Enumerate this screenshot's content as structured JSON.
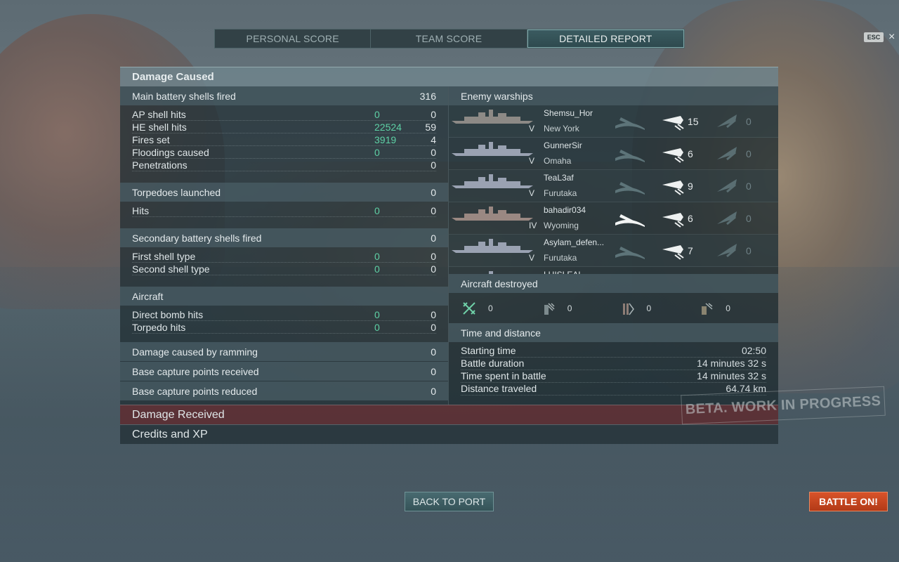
{
  "tabs": [
    {
      "label": "PERSONAL SCORE",
      "active": false
    },
    {
      "label": "TEAM SCORE",
      "active": false
    },
    {
      "label": "DETAILED REPORT",
      "active": true
    }
  ],
  "esc_label": "ESC",
  "close_label": "×",
  "damage_caused": {
    "title": "Damage Caused",
    "main_battery": {
      "header": "Main battery shells fired",
      "header_value": "316",
      "rows": [
        {
          "label": "AP shell hits",
          "damage": "0",
          "count": "0"
        },
        {
          "label": "HE shell hits",
          "damage": "22524",
          "count": "59"
        },
        {
          "label": "Fires set",
          "damage": "3919",
          "count": "4"
        },
        {
          "label": "Floodings caused",
          "damage": "0",
          "count": "0"
        },
        {
          "label": "Penetrations",
          "damage": "",
          "count": "0"
        }
      ]
    },
    "torpedoes": {
      "header": "Torpedoes launched",
      "header_value": "0",
      "rows": [
        {
          "label": "Hits",
          "damage": "0",
          "count": "0"
        }
      ]
    },
    "secondary": {
      "header": "Secondary battery shells fired",
      "header_value": "0",
      "rows": [
        {
          "label": "First shell type",
          "damage": "0",
          "count": "0"
        },
        {
          "label": "Second shell type",
          "damage": "0",
          "count": "0"
        }
      ]
    },
    "aircraft": {
      "header": "Aircraft",
      "header_value": "",
      "rows": [
        {
          "label": "Direct bomb hits",
          "damage": "0",
          "count": "0"
        },
        {
          "label": "Torpedo hits",
          "damage": "0",
          "count": "0"
        }
      ]
    },
    "ramming": {
      "label": "Damage caused by ramming",
      "value": "0"
    },
    "capture_received": {
      "label": "Base capture points received",
      "value": "0"
    },
    "capture_reduced": {
      "label": "Base capture points reduced",
      "value": "0"
    }
  },
  "enemy_warships": {
    "header": "Enemy warships",
    "ships": [
      {
        "player": "Shemsu_Hor",
        "ship": "New York",
        "tier": "V",
        "hits": "15",
        "other": "0",
        "sunk": false,
        "hull": "#8d8a86"
      },
      {
        "player": "GunnerSir",
        "ship": "Omaha",
        "tier": "V",
        "hits": "6",
        "other": "0",
        "sunk": false,
        "hull": "#9aa2b2"
      },
      {
        "player": "TeaL3af",
        "ship": "Furutaka",
        "tier": "V",
        "hits": "9",
        "other": "0",
        "sunk": false,
        "hull": "#9aa2b2"
      },
      {
        "player": "bahadir034",
        "ship": "Wyoming",
        "tier": "IV",
        "hits": "6",
        "other": "0",
        "sunk": true,
        "hull": "#9a8882"
      },
      {
        "player": "Asylam_defen...",
        "ship": "Furutaka",
        "tier": "V",
        "hits": "7",
        "other": "0",
        "sunk": false,
        "hull": "#9aa2b2"
      },
      {
        "player": "LUISLEAL",
        "ship": "",
        "tier": "",
        "hits": "",
        "other": "",
        "sunk": false,
        "hull": "#9aa2b2"
      }
    ]
  },
  "aircraft_destroyed": {
    "header": "Aircraft destroyed",
    "items": [
      {
        "icon": "fighter-icon",
        "value": "0"
      },
      {
        "icon": "dive-bomber-icon",
        "value": "0"
      },
      {
        "icon": "torpedo-bomber-icon",
        "value": "0"
      },
      {
        "icon": "catapult-fighter-icon",
        "value": "0"
      }
    ]
  },
  "time_distance": {
    "header": "Time and distance",
    "rows": [
      {
        "label": "Starting time",
        "value": "02:50"
      },
      {
        "label": "Battle duration",
        "value": "14 minutes 32 s"
      },
      {
        "label": "Time spent in battle",
        "value": "14 minutes 32 s"
      },
      {
        "label": "Distance traveled",
        "value": "64.74 km"
      }
    ]
  },
  "damage_received": "Damage Received",
  "credits_xp": "Credits and XP",
  "watermark": "BETA. WORK IN PROGRESS",
  "buttons": {
    "back": "BACK TO PORT",
    "battle": "BATTLE ON!"
  },
  "colors": {
    "accent_green": "#5ed0a5",
    "battle_button": "#c8451f",
    "damage_received_bar": "#60282c"
  }
}
